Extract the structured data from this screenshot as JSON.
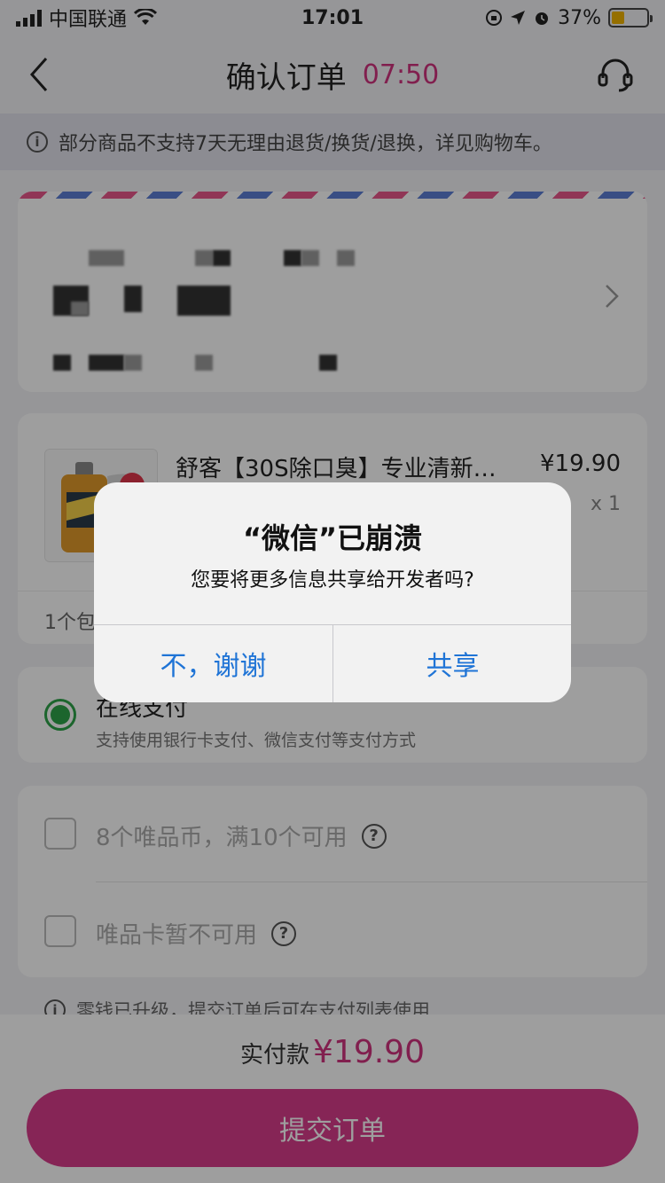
{
  "status_bar": {
    "carrier": "中国联通",
    "time": "17:01",
    "battery_percent": "37%",
    "battery_level": 0.37
  },
  "nav": {
    "title": "确认订单",
    "countdown": "07:50"
  },
  "notice": {
    "text": "部分商品不支持7天无理由退货/换货/退换，详见购物车。"
  },
  "product": {
    "name": "舒客【30S除口臭】专业清新…",
    "price": "¥19.90",
    "quantity": "x 1",
    "package_label": "1个包"
  },
  "payment": {
    "method_title": "在线支付",
    "method_sub": "支持使用银行卡支付、微信支付等支付方式"
  },
  "coupons": {
    "coins_label": "8个唯品币，满10个可用",
    "card_label": "唯品卡暂不可用",
    "help_symbol": "?"
  },
  "change_note": "零钱已升级，提交订单后可在支付列表使用",
  "footer": {
    "total_label": "实付款",
    "total_amount": "¥19.90",
    "submit_label": "提交订单"
  },
  "alert": {
    "title": "“微信”已崩溃",
    "message": "您要将更多信息共享给开发者吗?",
    "cancel_label": "不，谢谢",
    "confirm_label": "共享"
  },
  "colors": {
    "accent": "#d93d8c",
    "countdown": "#d0337f",
    "radio": "#2ea449",
    "ios_blue": "#1f74d6"
  },
  "icons": {
    "back": "chevron-left-icon",
    "service": "headset-icon",
    "info": "info-icon",
    "address_chevron": "chevron-right-icon",
    "help": "question-icon"
  }
}
